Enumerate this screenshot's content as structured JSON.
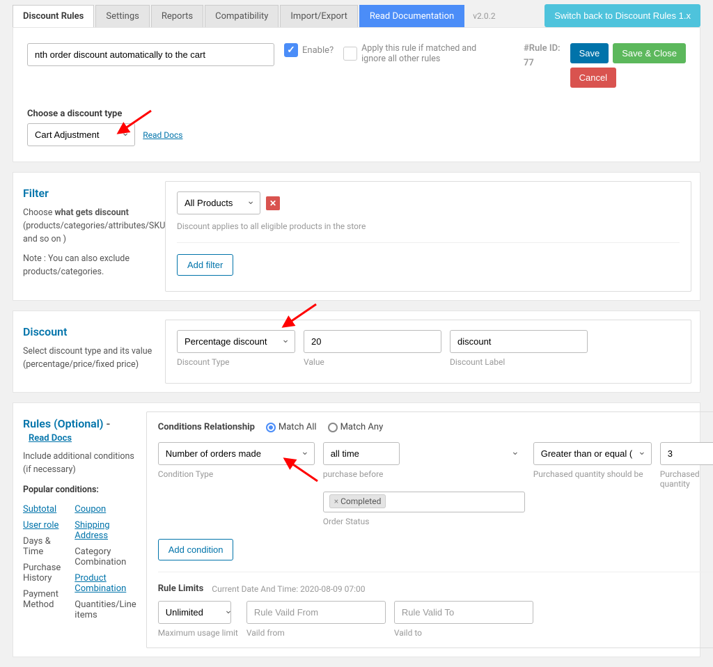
{
  "tabs": {
    "items": [
      "Discount Rules",
      "Settings",
      "Reports",
      "Compatibility",
      "Import/Export"
    ],
    "doc": "Read Documentation",
    "version": "v2.0.2",
    "switch": "Switch back to Discount Rules 1.x"
  },
  "header": {
    "rule_name": "nth order discount automatically to the cart",
    "enable_label": "Enable?",
    "apply_label": "Apply this rule if matched and ignore all other rules",
    "rule_id_label": "#Rule ID:",
    "rule_id_value": "77",
    "save": "Save",
    "save_close": "Save & Close",
    "cancel": "Cancel",
    "discount_type_label": "Choose a discount type",
    "discount_type_value": "Cart Adjustment",
    "read_docs": "Read Docs"
  },
  "filter": {
    "title": "Filter",
    "desc1_prefix": "Choose ",
    "desc1_bold": "what gets discount",
    "desc1_rest": " (products/categories/attributes/SKU and so on )",
    "note": "Note : You can also exclude products/categories.",
    "select_value": "All Products",
    "applies_text": "Discount applies to all eligible products in the store",
    "add_filter": "Add filter"
  },
  "discount": {
    "title": "Discount",
    "desc": "Select discount type and its value (percentage/price/fixed price)",
    "type_value": "Percentage discount",
    "type_label": "Discount Type",
    "value": "20",
    "value_label": "Value",
    "label_value": "discount",
    "label_label": "Discount Label"
  },
  "rules": {
    "title": "Rules (Optional)",
    "read_docs": "Read Docs",
    "desc": "Include additional conditions (if necessary)",
    "popular_label": "Popular conditions:",
    "links_col1": [
      "Subtotal",
      "User role",
      "Days & Time",
      "Purchase History",
      "Payment Method"
    ],
    "links_col2": [
      "Coupon",
      "Shipping Address",
      "Category Combination",
      "Product Combination",
      "Quantities/Line items"
    ],
    "conditions_relationship": "Conditions Relationship",
    "match_all": "Match All",
    "match_any": "Match Any",
    "condition_type_value": "Number of orders made",
    "condition_type_label": "Condition Type",
    "purchase_before_value": "all time",
    "purchase_before_label": "purchase before",
    "qty_should_value": "Greater than or equal ( >= )",
    "qty_should_label": "Purchased quantity should be",
    "qty_value": "3",
    "qty_label": "Purchased quantity",
    "order_status_tag": "Completed",
    "order_status_label": "Order Status",
    "add_condition": "Add condition",
    "rule_limits_label": "Rule Limits",
    "current_date": "Current Date And Time: 2020-08-09 07:00",
    "unlimited": "Unlimited",
    "usage_label": "Maximum usage limit",
    "valid_from_ph": "Rule Vaild From",
    "valid_from_label": "Vaild from",
    "valid_to_ph": "Rule Valid To",
    "valid_to_label": "Vaild to"
  }
}
